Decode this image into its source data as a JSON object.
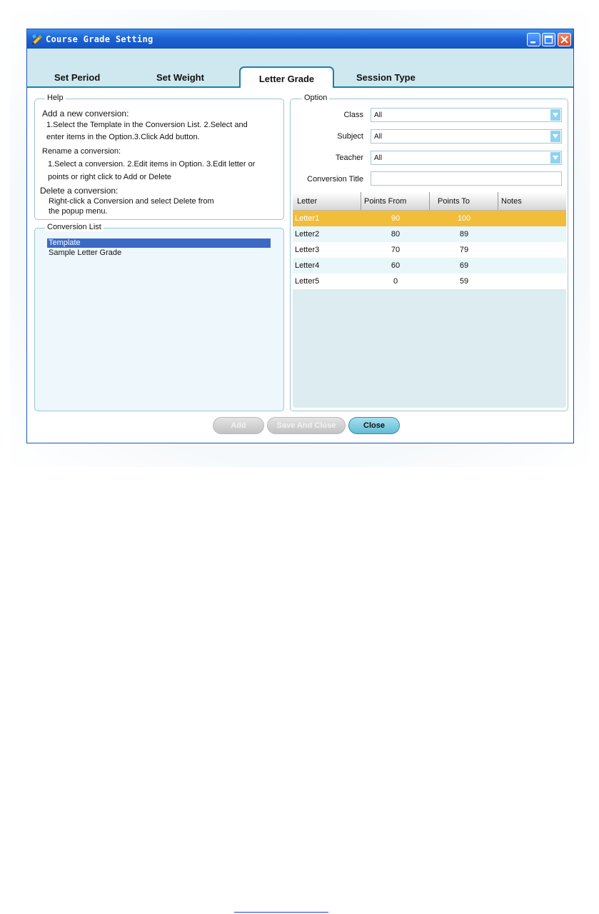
{
  "window": {
    "title": "Course Grade Setting"
  },
  "tabs": [
    {
      "label": "Set Period"
    },
    {
      "label": "Set Weight"
    },
    {
      "label": "Letter Grade",
      "active": true
    },
    {
      "label": "Session Type"
    }
  ],
  "help": {
    "legend": "Help",
    "lines": [
      "Add a new conversion:",
      "1.Select the Template in the Conversion List. 2.Select and",
      "enter items in the Option.3.Click Add button.",
      "Rename a conversion:",
      "1.Select a conversion. 2.Edit items in Option. 3.Edit letter or",
      "points or right click to Add or Delete",
      "Delete a conversion:",
      "Right-click a Conversion and select Delete from",
      "the popup menu."
    ]
  },
  "conversion_list": {
    "legend": "Conversion List",
    "items": [
      "Template",
      "Sample Letter Grade"
    ],
    "selected": "Template"
  },
  "option": {
    "legend": "Option",
    "class": {
      "label": "Class",
      "value": "All"
    },
    "subject": {
      "label": "Subject",
      "value": "All"
    },
    "teacher": {
      "label": "Teacher",
      "value": "All"
    },
    "conversion_title": {
      "label": "Conversion Title",
      "value": ""
    }
  },
  "grid": {
    "headers": [
      "Letter",
      "Points From",
      "Points To",
      "Notes"
    ],
    "rows": [
      [
        "Letter1",
        "90",
        "100",
        ""
      ],
      [
        "Letter2",
        "80",
        "89",
        ""
      ],
      [
        "Letter3",
        "70",
        "79",
        ""
      ],
      [
        "Letter4",
        "60",
        "69",
        ""
      ],
      [
        "Letter5",
        "0",
        "59",
        ""
      ]
    ]
  },
  "buttons": {
    "add": "Add",
    "save_and_close": "Save And Close",
    "close": "Close"
  },
  "colors": {
    "titlebar": "#1e63d6",
    "tab_accent": "#1b7fa6",
    "selected_row": "#f1bd3a",
    "list_selection": "#3a6ac6"
  }
}
